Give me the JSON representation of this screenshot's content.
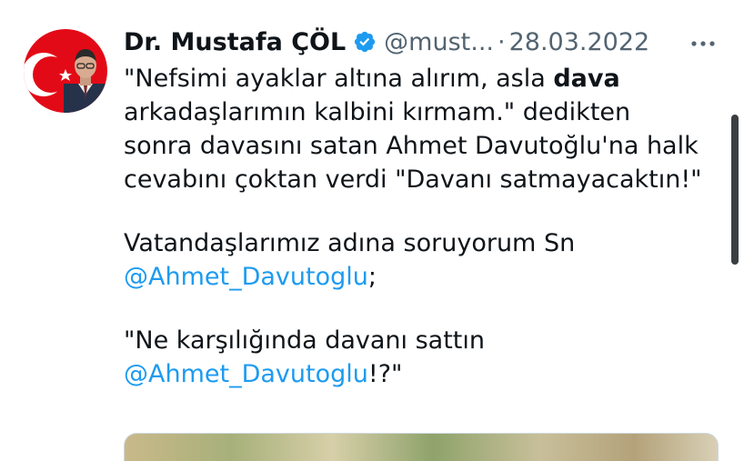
{
  "tweet": {
    "display_name": "Dr. Mustafa ÇÖL",
    "handle": "@must...",
    "separator": "·",
    "date": "28.03.2022",
    "body": {
      "l1a": "\"Nefsimi ayaklar altına alırım, asla ",
      "l1b": "dava",
      "l2": "arkadaşlarımın kalbini kırmam.\" dedikten",
      "l3": "sonra davasını satan Ahmet Davutoğlu'na halk",
      "l4": "cevabını çoktan verdi \"Davanı satmayacaktın!\"",
      "l5": "Vatandaşlarımız adına soruyorum Sn",
      "l6_mention": "@Ahmet_Davutoglu",
      "l6_rest": ";",
      "l7": "\"Ne karşılığında davanı sattın",
      "l8_mention": "@Ahmet_Davutoglu",
      "l8_rest": "!?\""
    }
  },
  "icons": {
    "verified": "verified-badge-icon",
    "more": "more-options-icon"
  },
  "colors": {
    "text": "#0f1419",
    "secondary": "#536471",
    "link": "#1d9bf0",
    "verified": "#1d9bf0",
    "avatar_bg": "#e30a17"
  }
}
